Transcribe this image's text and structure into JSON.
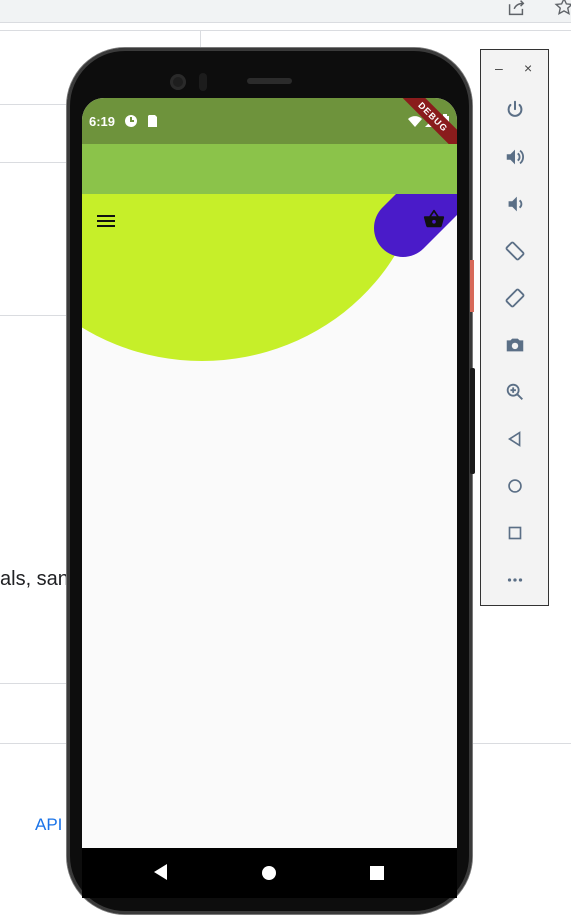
{
  "browser": {
    "icons": [
      "share-icon",
      "star-icon"
    ]
  },
  "background_page": {
    "text_fragment": "als, san",
    "link_text": "API"
  },
  "device": {
    "status_bar": {
      "time": "6:19",
      "left_icons": [
        "data-saver-icon",
        "sd-card-icon"
      ],
      "right_icons": [
        "wifi-icon",
        "signal-icon",
        "battery-icon"
      ],
      "debug_banner": "DEBUG",
      "color": "#6e933c"
    },
    "app_bar": {
      "color": "#8bc34a"
    },
    "app": {
      "menu_icon": "menu-icon",
      "basket_icon": "shopping-basket-icon",
      "circle_color": "#c6ef29",
      "pill_color": "#4a1bc9",
      "background": "#fafafa"
    },
    "nav_bar": [
      "back-icon",
      "home-icon",
      "recents-icon"
    ]
  },
  "emulator_panel": {
    "window_controls": [
      "minimize-icon",
      "close-icon"
    ],
    "minimize_glyph": "–",
    "close_glyph": "×",
    "tools": [
      "power-icon",
      "volume-up-icon",
      "volume-down-icon",
      "rotate-left-icon",
      "rotate-right-icon",
      "screenshot-icon",
      "zoom-icon",
      "back-icon",
      "home-icon",
      "overview-icon",
      "more-icon"
    ]
  }
}
